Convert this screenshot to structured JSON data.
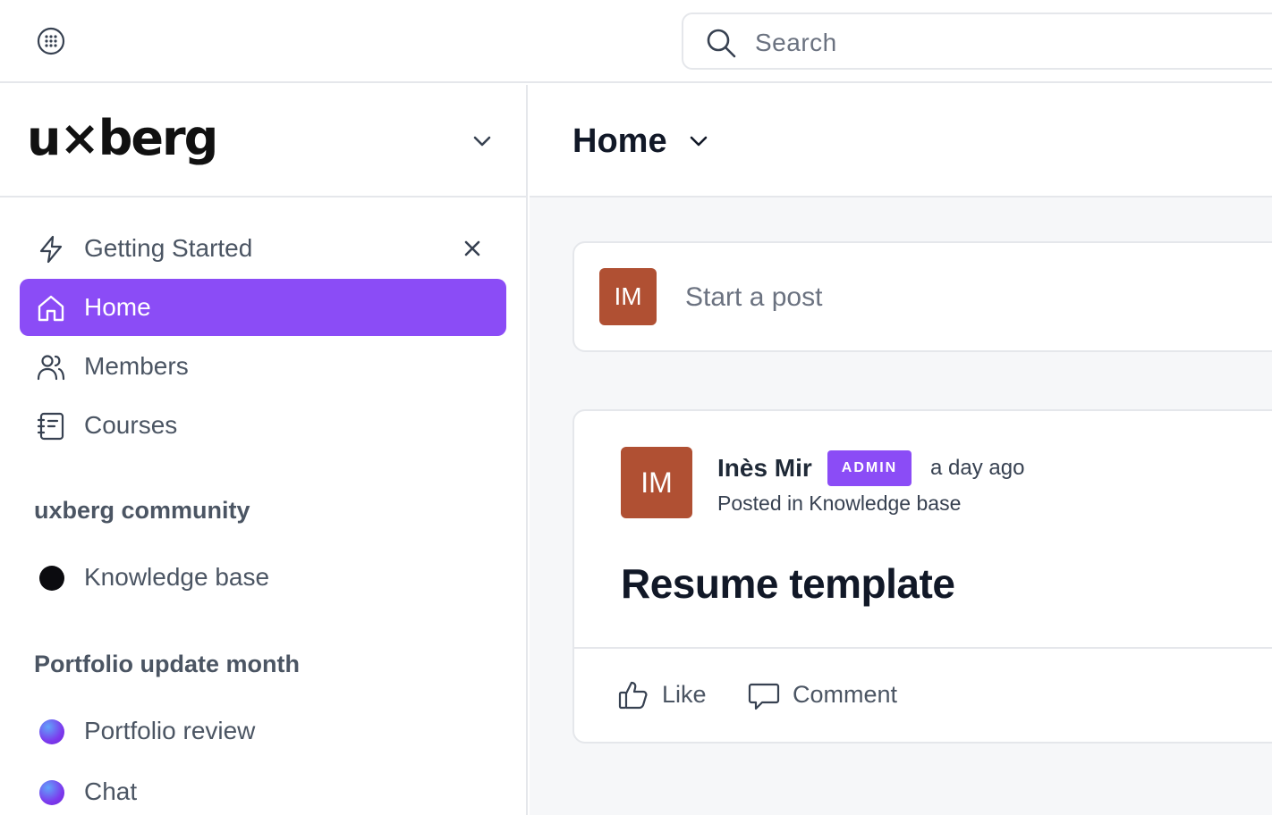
{
  "topbar": {
    "app_icon": "dial-pad-icon",
    "search": {
      "icon": "search-icon",
      "placeholder": "Search"
    }
  },
  "sidebar": {
    "brand": {
      "logo_text": "u×berg",
      "chevron": "chevron-down-icon"
    },
    "items": [
      {
        "label": "Getting Started",
        "icon": "lightning-icon",
        "closable": true
      },
      {
        "label": "Home",
        "icon": "home-icon",
        "active": true
      },
      {
        "label": "Members",
        "icon": "members-icon"
      },
      {
        "label": "Courses",
        "icon": "courses-icon"
      }
    ],
    "sections": [
      {
        "title": "uxberg community",
        "items": [
          {
            "label": "Knowledge base",
            "icon": "black-dot-icon"
          }
        ]
      },
      {
        "title": "Portfolio update month",
        "items": [
          {
            "label": "Portfolio review",
            "icon": "gradient-dot-icon"
          },
          {
            "label": "Chat",
            "icon": "gradient-dot-icon"
          }
        ]
      }
    ]
  },
  "main": {
    "title": "Home",
    "composer": {
      "avatar_initials": "IM",
      "placeholder": "Start a post"
    },
    "post": {
      "avatar_initials": "IM",
      "author": "Inès Mir",
      "badge": "ADMIN",
      "time": "a day ago",
      "posted_in": "Posted in Knowledge base",
      "title": "Resume template",
      "actions": [
        {
          "label": "Like",
          "icon": "thumbs-up-icon"
        },
        {
          "label": "Comment",
          "icon": "comment-icon"
        }
      ]
    }
  },
  "colors": {
    "accent": "#8b4cf6",
    "avatar": "#b05033",
    "border": "#e5e7eb",
    "main_bg": "#f6f7f9"
  }
}
